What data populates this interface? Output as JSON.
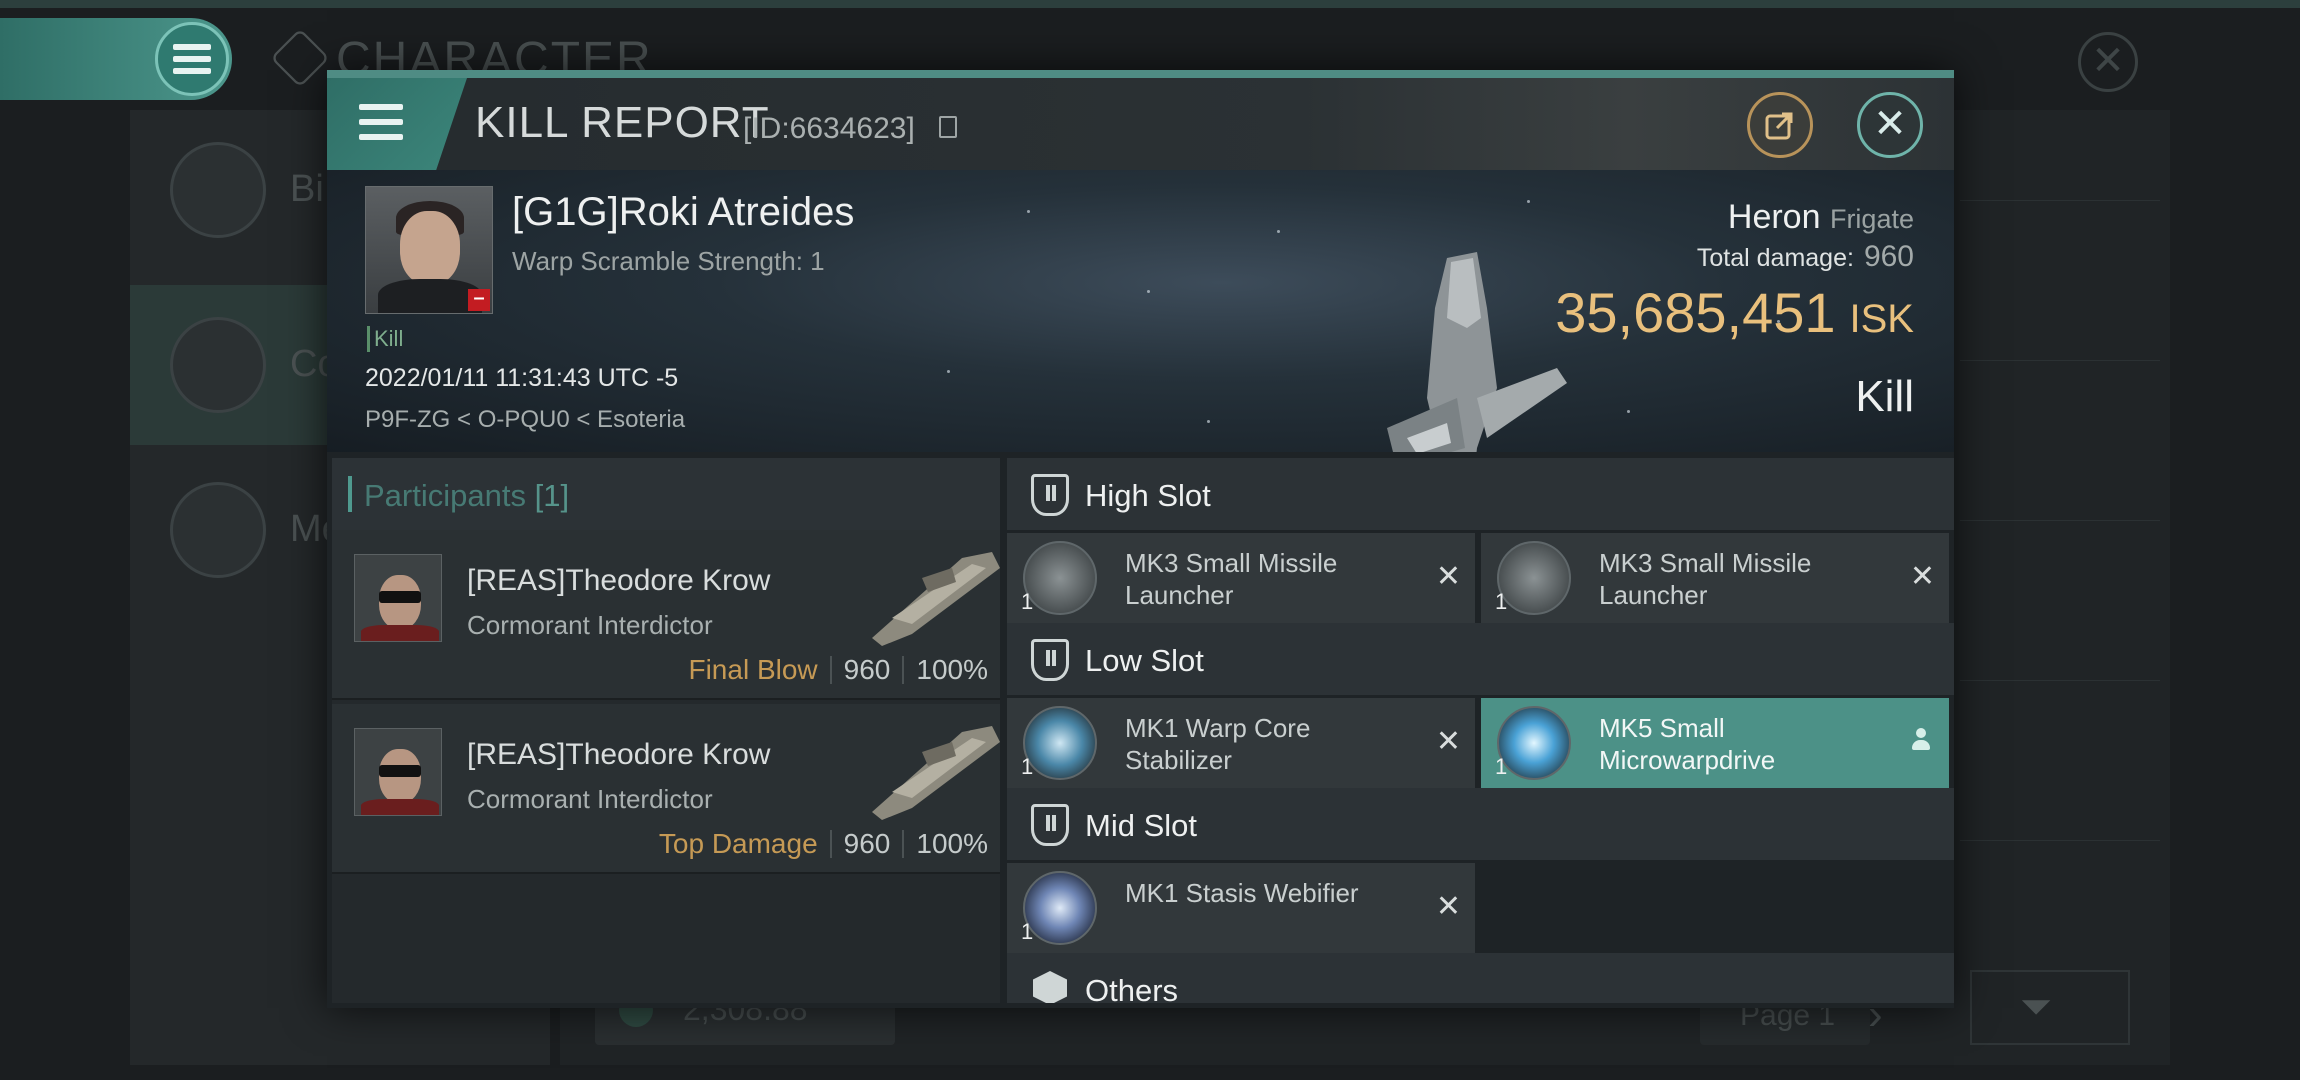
{
  "background": {
    "title": "CHARACTER",
    "sidebar": [
      {
        "label": "Bi"
      },
      {
        "label": "Co"
      },
      {
        "label": "Me"
      }
    ],
    "bottom_value": "2,308.88",
    "page_label": "Page 1"
  },
  "modal": {
    "title": "KILL REPORT",
    "id_text": "[ID:6634623]"
  },
  "victim": {
    "name": "[G1G]Roki Atreides",
    "subtitle": "Warp Scramble Strength: 1",
    "kill_tag": "Kill",
    "timestamp": "2022/01/11 11:31:43 UTC -5",
    "location": "P9F-ZG < O-PQU0 < Esoteria",
    "ship_name": "Heron",
    "ship_class": "Frigate",
    "total_damage_label": "Total damage:",
    "total_damage_value": "960",
    "isk_value": "35,685,451",
    "isk_unit": "ISK",
    "result": "Kill"
  },
  "participants": {
    "label": "Participants",
    "count": "[1]",
    "rows": [
      {
        "name": "[REAS]Theodore Krow",
        "ship": "Cormorant Interdictor",
        "tag": "Final Blow",
        "damage": "960",
        "percent": "100%"
      },
      {
        "name": "[REAS]Theodore Krow",
        "ship": "Cormorant Interdictor",
        "tag": "Top Damage",
        "damage": "960",
        "percent": "100%"
      }
    ]
  },
  "slots": {
    "high": {
      "label": "High Slot",
      "items": [
        {
          "name": "MK3 Small Missile Launcher",
          "qty": "1"
        },
        {
          "name": "MK3 Small Missile Launcher",
          "qty": "1"
        }
      ]
    },
    "low": {
      "label": "Low Slot",
      "items": [
        {
          "name": "MK1 Warp Core Stabilizer",
          "qty": "1"
        },
        {
          "name": "MK5 Small Microwarpdrive",
          "qty": "1"
        }
      ]
    },
    "mid": {
      "label": "Mid Slot",
      "items": [
        {
          "name": "MK1 Stasis Webifier",
          "qty": "1"
        }
      ]
    },
    "others": {
      "label": "Others"
    }
  }
}
